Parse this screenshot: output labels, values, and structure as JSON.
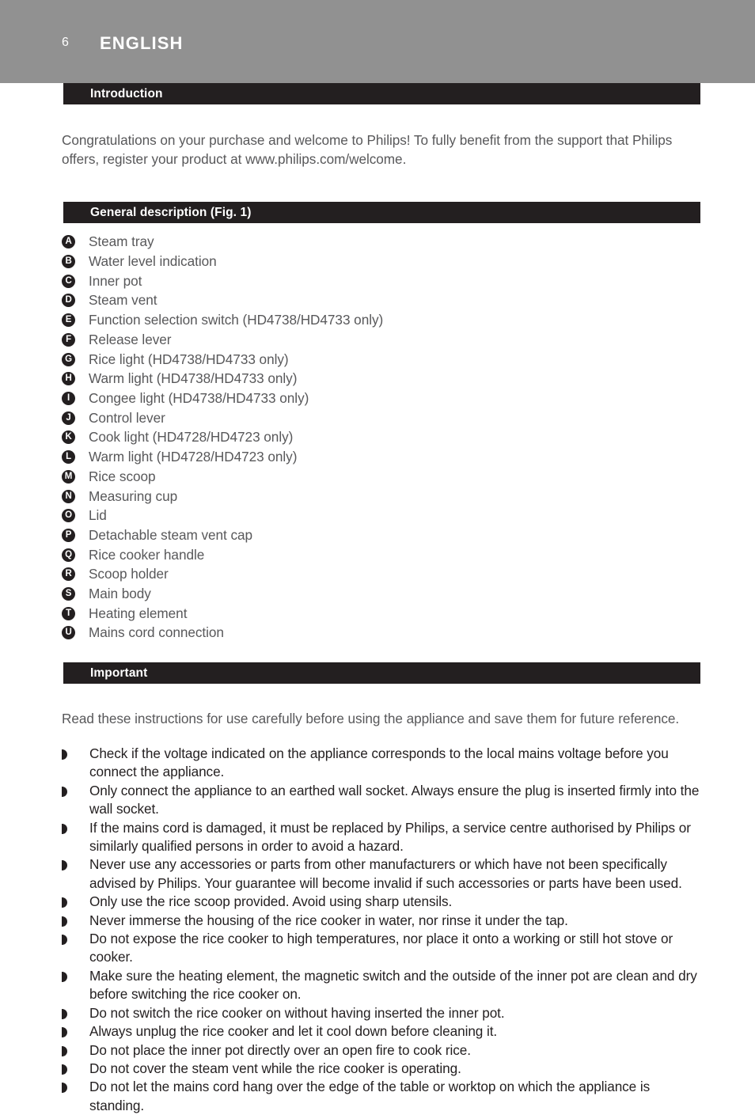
{
  "header": {
    "page_number": "6",
    "language": "ENGLISH",
    "band_color": "#919191",
    "text_color": "#ffffff"
  },
  "theme": {
    "bar_color": "#231f20",
    "body_text_color": "#58585a",
    "bullet_text_color": "#231f20",
    "page_background": "#ffffff"
  },
  "sections": {
    "introduction": {
      "title": "Introduction",
      "paragraph": "Congratulations on your purchase and welcome to Philips! To fully benefit from the support that Philips offers, register your product at www.philips.com/welcome."
    },
    "general_description": {
      "title": "General description (Fig. 1)",
      "items": [
        {
          "letter": "A",
          "label": "Steam tray"
        },
        {
          "letter": "B",
          "label": "Water level indication"
        },
        {
          "letter": "C",
          "label": "Inner pot"
        },
        {
          "letter": "D",
          "label": "Steam vent"
        },
        {
          "letter": "E",
          "label": "Function selection switch (HD4738/HD4733 only)"
        },
        {
          "letter": "F",
          "label": "Release lever"
        },
        {
          "letter": "G",
          "label": "Rice light (HD4738/HD4733 only)"
        },
        {
          "letter": "H",
          "label": "Warm light (HD4738/HD4733 only)"
        },
        {
          "letter": "I",
          "label": "Congee light (HD4738/HD4733 only)"
        },
        {
          "letter": "J",
          "label": "Control lever"
        },
        {
          "letter": "K",
          "label": "Cook light (HD4728/HD4723 only)"
        },
        {
          "letter": "L",
          "label": "Warm light (HD4728/HD4723 only)"
        },
        {
          "letter": "M",
          "label": "Rice scoop"
        },
        {
          "letter": "N",
          "label": "Measuring cup"
        },
        {
          "letter": "O",
          "label": "Lid"
        },
        {
          "letter": "P",
          "label": "Detachable steam vent cap"
        },
        {
          "letter": "Q",
          "label": "Rice cooker handle"
        },
        {
          "letter": "R",
          "label": "Scoop holder"
        },
        {
          "letter": "S",
          "label": "Main body"
        },
        {
          "letter": "T",
          "label": "Heating element"
        },
        {
          "letter": "U",
          "label": "Mains cord connection"
        }
      ]
    },
    "important": {
      "title": "Important",
      "paragraph": "Read these instructions for use carefully before using the appliance and save them for future reference.",
      "bullets": [
        "Check if the voltage indicated on the appliance corresponds to the local mains voltage before you connect the appliance.",
        "Only connect the appliance to an earthed wall socket. Always ensure the plug is inserted firmly into the wall socket.",
        "If the mains cord is damaged, it must be replaced by Philips, a service centre authorised by Philips or similarly qualified persons in order to avoid a hazard.",
        "Never use any accessories or parts from other manufacturers or which have not been specifically advised by Philips. Your guarantee will become invalid if such accessories or parts have been used.",
        "Only use the rice scoop provided. Avoid using sharp utensils.",
        "Never immerse the housing of the rice cooker in water, nor rinse it under the tap.",
        "Do not expose the rice cooker to high temperatures, nor place it onto a working or still hot stove or cooker.",
        "Make sure the heating element, the magnetic switch and the outside of the inner pot are clean and dry before switching the rice cooker on.",
        "Do not switch the rice cooker on without having inserted the inner pot.",
        "Always unplug the rice cooker and let it cool down before cleaning it.",
        "Do not place the inner pot directly over an open fire to cook rice.",
        "Do not cover the steam vent while the rice cooker is operating.",
        "Do not let the mains cord hang over the edge of the table or worktop on which the appliance is standing."
      ]
    }
  }
}
